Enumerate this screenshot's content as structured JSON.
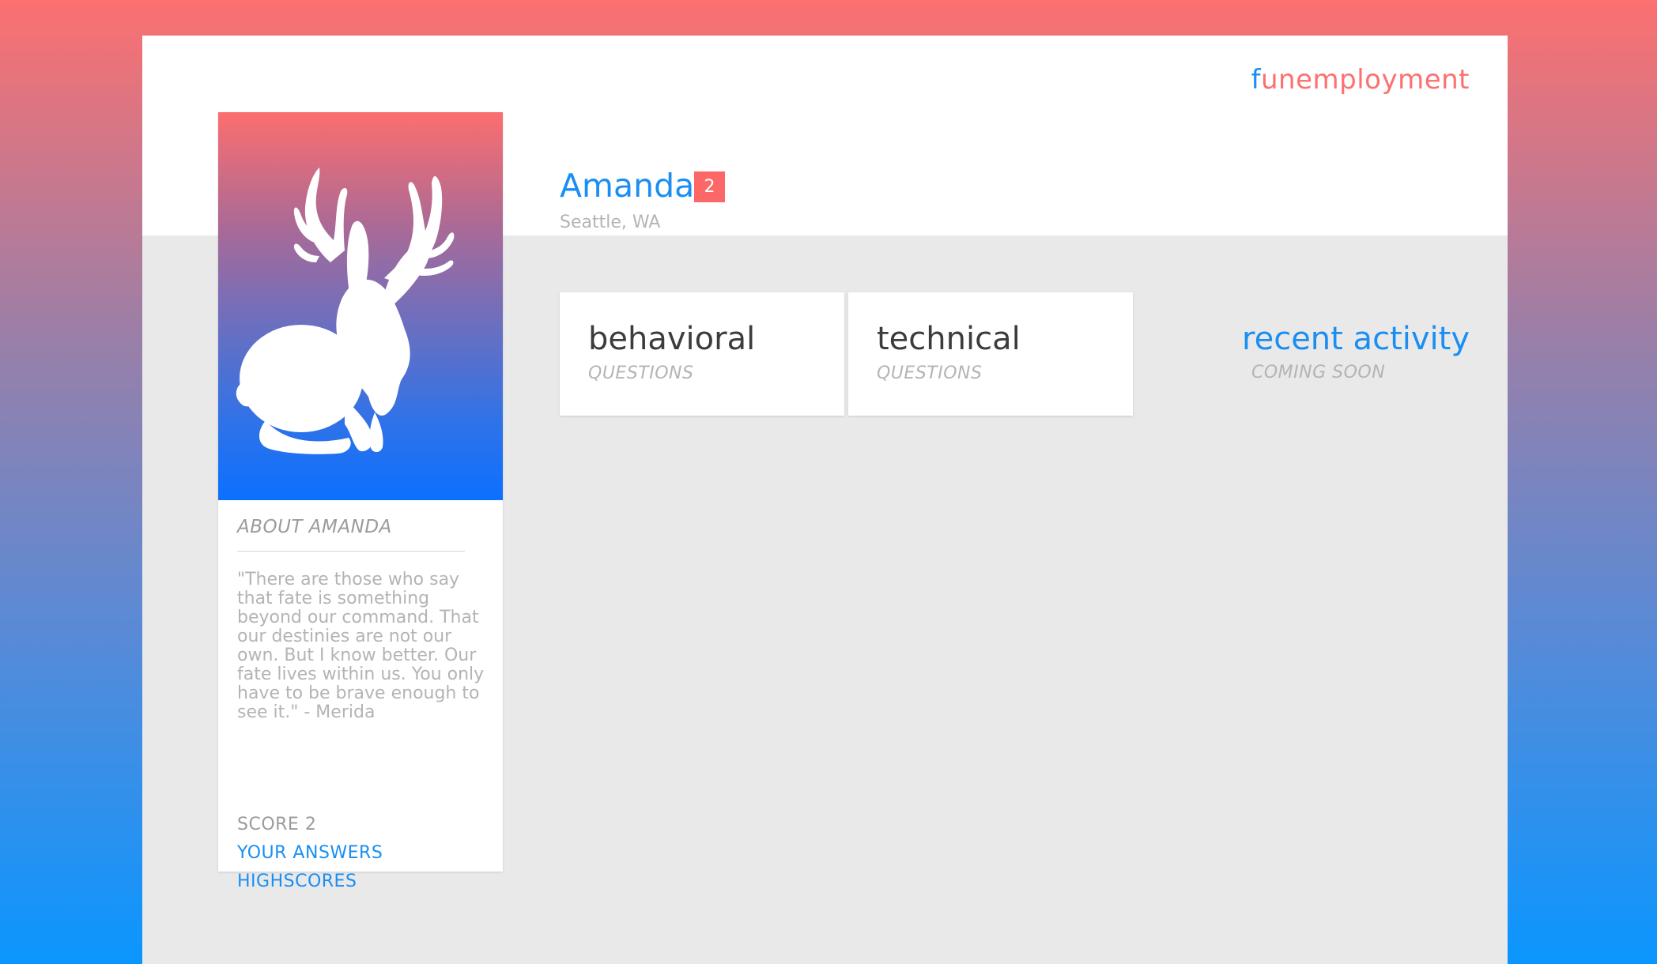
{
  "brand": {
    "first_letter": "f",
    "rest": "unemployment"
  },
  "user": {
    "name": "Amanda",
    "badge": "2",
    "location": "Seattle, WA"
  },
  "sidebar": {
    "avatar_icon": "jackalope-icon",
    "about_heading": "ABOUT AMANDA",
    "quote": "\"There are those who say that fate is something beyond our command. That our destinies are not our own. But I know better. Our fate lives within us. You only have to be brave enough to see it.\" - Merida",
    "score_label": "SCORE 2",
    "links": [
      {
        "label": "YOUR ANSWERS"
      },
      {
        "label": "HIGHSCORES"
      }
    ]
  },
  "categories": [
    {
      "title": "behavioral",
      "subtitle": "QUESTIONS"
    },
    {
      "title": "technical",
      "subtitle": "QUESTIONS"
    }
  ],
  "recent_activity": {
    "title": "recent activity",
    "subtitle": "COMING SOON"
  },
  "colors": {
    "accent_blue": "#1a8ef2",
    "accent_coral": "#fc7070",
    "badge": "#fc6868"
  }
}
